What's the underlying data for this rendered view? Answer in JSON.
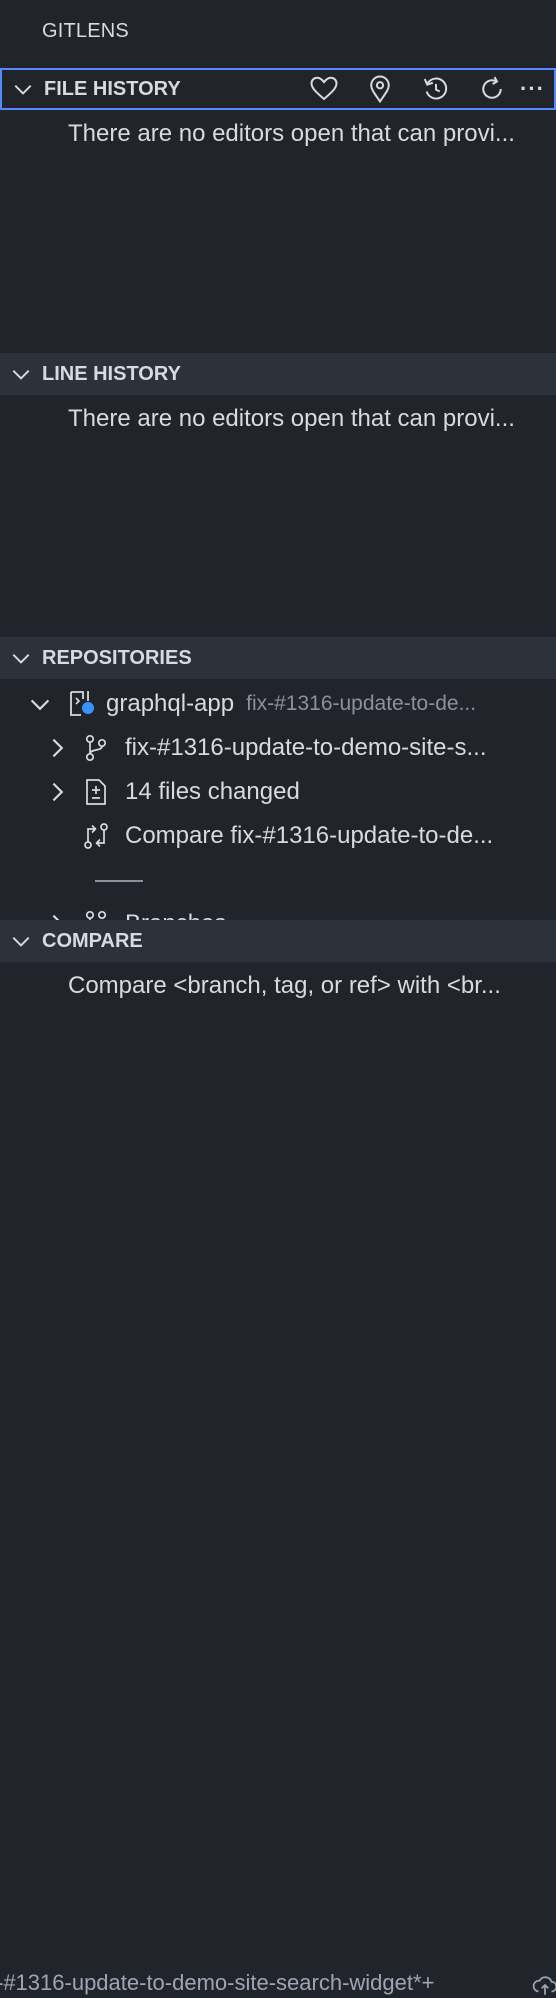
{
  "app": {
    "title": "GITLENS"
  },
  "sections": {
    "file_history": {
      "title": "FILE HISTORY",
      "message": "There are no editors open that can provi...",
      "actions": [
        "favorite-heart-icon",
        "location-pin-icon",
        "history-icon",
        "refresh-icon",
        "more-icon"
      ],
      "more_label": "···"
    },
    "line_history": {
      "title": "LINE HISTORY",
      "message": "There are no editors open that can provi..."
    },
    "repositories": {
      "title": "REPOSITORIES",
      "repo": {
        "name": "graphql-app",
        "branch_desc": "fix-#1316-update-to-de..."
      },
      "items": [
        {
          "label": "fix-#1316-update-to-demo-site-s..."
        },
        {
          "label": "14 files changed"
        },
        {
          "label": "Compare fix-#1316-update-to-de..."
        },
        {
          "label": "Branches"
        }
      ]
    },
    "compare": {
      "title": "COMPARE",
      "message": "Compare <branch, tag, or ref> with <br..."
    }
  },
  "status_bar": {
    "branch": "-#1316-update-to-demo-site-search-widget*+"
  },
  "colors": {
    "background": "#21252b",
    "header": "#2c313a",
    "focus_border": "#528bff",
    "repo_dot": "#3794ff"
  }
}
